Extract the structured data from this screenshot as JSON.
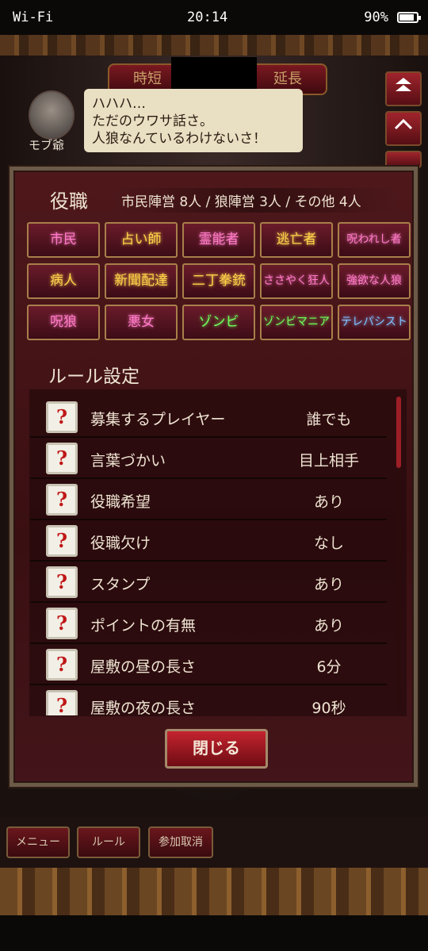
{
  "status_bar": {
    "network": "Wi-Fi",
    "time": "20:14",
    "battery": "90%"
  },
  "scene": {
    "time_shorten_label": "時短",
    "time_extend_label": "延長",
    "speaker_name": "モブ爺",
    "speech_lines": [
      "ハハハ…",
      "ただのウワサ話さ。",
      "人狼なんているわけないさ！"
    ]
  },
  "roles_panel": {
    "title": "役職",
    "summary": "市民陣営 8人 / 狼陣営 3人 / その他 4人",
    "roles": [
      {
        "label": "市民",
        "color": "pink"
      },
      {
        "label": "占い師",
        "color": "yellow"
      },
      {
        "label": "霊能者",
        "color": "pink"
      },
      {
        "label": "逃亡者",
        "color": "yellow"
      },
      {
        "label": "呪われし者",
        "color": "pink"
      },
      {
        "label": "病人",
        "color": "yellow"
      },
      {
        "label": "新聞配達",
        "color": "yellow"
      },
      {
        "label": "二丁拳銃",
        "color": "yellow"
      },
      {
        "label": "ささやく狂人",
        "color": "pink"
      },
      {
        "label": "強欲な人狼",
        "color": "pink"
      },
      {
        "label": "呪狼",
        "color": "pink"
      },
      {
        "label": "悪女",
        "color": "pink"
      },
      {
        "label": "ゾンビ",
        "color": "green"
      },
      {
        "label": "ゾンビマニア",
        "color": "green"
      },
      {
        "label": "テレパシスト",
        "color": "blue"
      }
    ]
  },
  "rules_panel": {
    "title": "ルール設定",
    "help_icon": "?",
    "rows": [
      {
        "label": "募集するプレイヤー",
        "value": "誰でも"
      },
      {
        "label": "言葉づかい",
        "value": "目上相手"
      },
      {
        "label": "役職希望",
        "value": "あり"
      },
      {
        "label": "役職欠け",
        "value": "なし"
      },
      {
        "label": "スタンプ",
        "value": "あり"
      },
      {
        "label": "ポイントの有無",
        "value": "あり"
      },
      {
        "label": "屋敷の昼の長さ",
        "value": "6分"
      },
      {
        "label": "屋敷の夜の長さ",
        "value": "90秒"
      }
    ]
  },
  "close_button": "閉じる",
  "bottom_buttons": {
    "menu": "メニュー",
    "rules": "ルール",
    "cancel": "参加取消"
  },
  "colors": {
    "pink": "#ff7ac6",
    "yellow": "#ffd24a",
    "green": "#6fff5a",
    "blue": "#7fbfff",
    "panel": "#4f181b"
  }
}
